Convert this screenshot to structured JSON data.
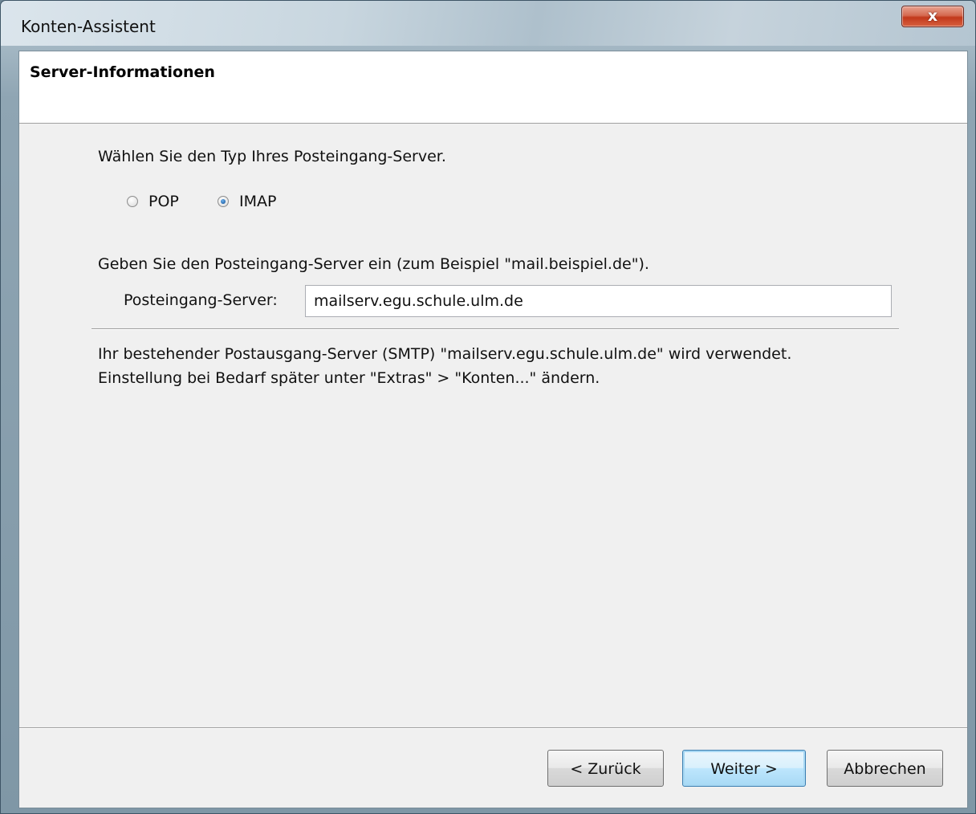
{
  "window": {
    "title": "Konten-Assistent",
    "close_label": "x"
  },
  "header": {
    "title": "Server-Informationen"
  },
  "server_type": {
    "prompt": "Wählen Sie den Typ Ihres Posteingang-Server.",
    "options": [
      {
        "label": "POP",
        "checked": false
      },
      {
        "label": "IMAP",
        "checked": true
      }
    ]
  },
  "incoming": {
    "prompt": "Geben Sie den Posteingang-Server ein (zum Beispiel \"mail.beispiel.de\").",
    "label": "Posteingang-Server:",
    "value": "mailserv.egu.schule.ulm.de"
  },
  "smtp_info": {
    "line1": "Ihr bestehender Postausgang-Server (SMTP) \"mailserv.egu.schule.ulm.de\" wird verwendet.",
    "line2": "Einstellung bei Bedarf später unter \"Extras\" > \"Konten...\" ändern."
  },
  "buttons": {
    "back": "< Zurück",
    "next": "Weiter >",
    "cancel": "Abbrechen"
  }
}
